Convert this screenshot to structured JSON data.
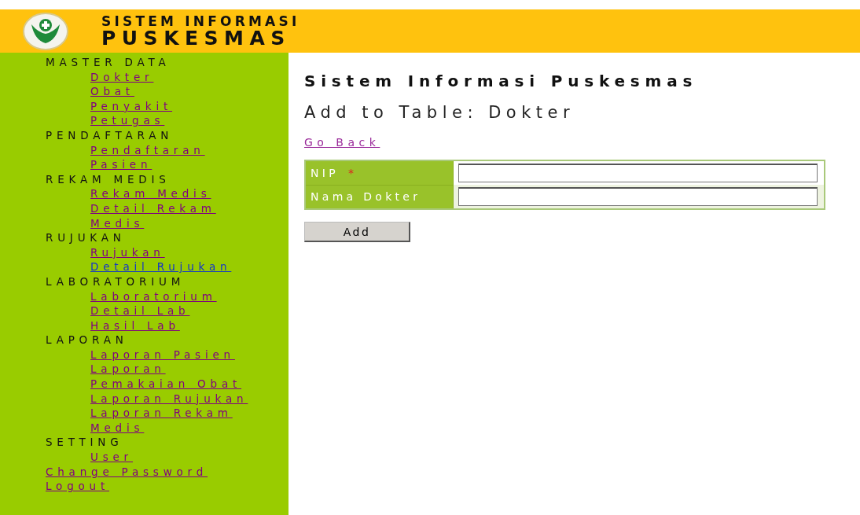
{
  "header": {
    "title_line_1": "SISTEM INFORMASI",
    "title_line_2": "PUSKESMAS"
  },
  "sidebar": {
    "sections": [
      {
        "heading": "MASTER DATA",
        "links": [
          {
            "label": "Dokter",
            "visited": true
          },
          {
            "label": "Obat",
            "visited": true
          },
          {
            "label": "Penyakit",
            "visited": true
          },
          {
            "label": "Petugas",
            "visited": true
          }
        ]
      },
      {
        "heading": "PENDAFTARAN",
        "links": [
          {
            "label": "Pendaftaran Pasien",
            "visited": true
          }
        ]
      },
      {
        "heading": "REKAM MEDIS",
        "links": [
          {
            "label": "Rekam Medis",
            "visited": true
          },
          {
            "label": "Detail Rekam Medis",
            "visited": true
          }
        ]
      },
      {
        "heading": "RUJUKAN",
        "links": [
          {
            "label": "Rujukan",
            "visited": true
          },
          {
            "label": "Detail Rujukan",
            "visited": false
          }
        ]
      },
      {
        "heading": "LABORATORIUM",
        "links": [
          {
            "label": "Laboratorium",
            "visited": true
          },
          {
            "label": "Detail Lab",
            "visited": true
          },
          {
            "label": "Hasil Lab",
            "visited": true
          }
        ]
      },
      {
        "heading": "LAPORAN",
        "links": [
          {
            "label": "Laporan Pasien",
            "visited": true
          },
          {
            "label": "Laporan Pemakaian Obat",
            "visited": true
          },
          {
            "label": "Laporan Rujukan",
            "visited": true
          },
          {
            "label": "Laporan Rekam Medis",
            "visited": true
          }
        ]
      },
      {
        "heading": "SETTING",
        "links": [
          {
            "label": "User",
            "visited": true
          }
        ]
      }
    ],
    "bottom_links": [
      {
        "label": "Change Password",
        "visited": true
      },
      {
        "label": "Logout",
        "visited": true
      }
    ]
  },
  "content": {
    "title": "Sistem Informasi Puskesmas",
    "subtitle": "Add to Table: Dokter",
    "back_link": {
      "label": "Go Back",
      "visited": true
    },
    "form": {
      "fields": [
        {
          "label": "NIP",
          "required_mark": "*"
        },
        {
          "label": "Nama Dokter"
        }
      ]
    },
    "submit": "Add"
  }
}
